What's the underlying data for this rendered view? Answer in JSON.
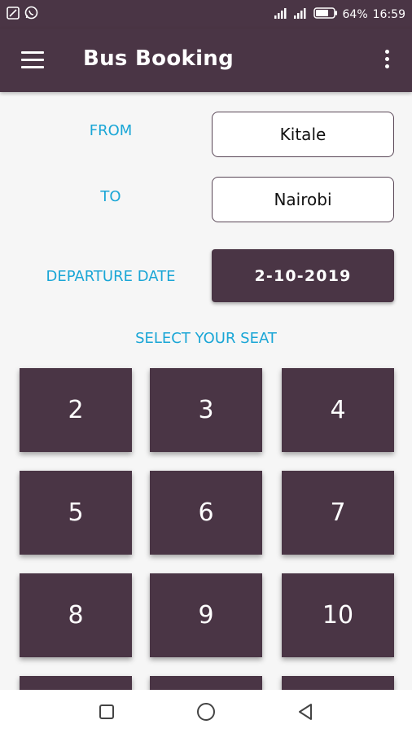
{
  "status_bar": {
    "battery": "64%",
    "time": "16:59",
    "icons": [
      "screenshot-icon",
      "whatsapp-icon",
      "signal-icon",
      "signal-icon",
      "battery-icon"
    ]
  },
  "app_bar": {
    "title": "Bus Booking",
    "menu_icon": "hamburger-menu-icon",
    "overflow_icon": "overflow-menu-icon"
  },
  "form": {
    "from_label": "FROM",
    "from_value": "Kitale",
    "to_label": "TO",
    "to_value": "Nairobi",
    "date_label": "DEPARTURE DATE",
    "date_value": "2-10-2019"
  },
  "seats": {
    "heading": "SELECT YOUR SEAT",
    "numbers": [
      "2",
      "3",
      "4",
      "5",
      "6",
      "7",
      "8",
      "9",
      "10",
      "",
      "",
      ""
    ]
  },
  "nav_bar": {
    "icons": [
      "recents-square-icon",
      "home-circle-icon",
      "back-triangle-icon"
    ]
  },
  "colors": {
    "primary": "#4a3545",
    "accent": "#1aa6d6",
    "background": "#f6f6f6"
  }
}
